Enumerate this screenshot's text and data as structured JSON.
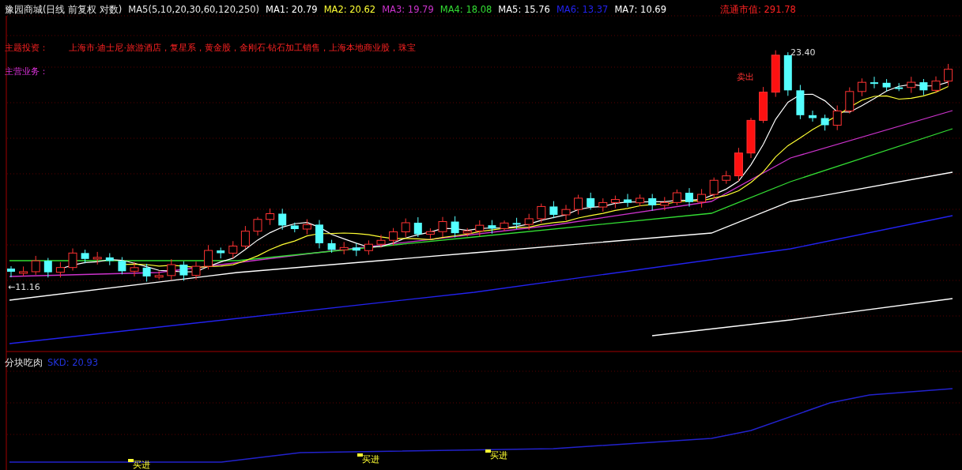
{
  "header": {
    "title": "豫园商城(日线 前复权 对数)",
    "indicator": "MA5(5,10,20,30,60,120,250)",
    "ma_values": [
      {
        "label": "MA1: 20.79",
        "color": "#ffffff"
      },
      {
        "label": "MA2: 20.62",
        "color": "#ffff33"
      },
      {
        "label": "MA3: 19.79",
        "color": "#cc33cc"
      },
      {
        "label": "MA4: 18.08",
        "color": "#33dd33"
      },
      {
        "label": "MA5: 15.76",
        "color": "#ffffff"
      },
      {
        "label": "MA6: 13.37",
        "color": "#2222ee"
      },
      {
        "label": "MA7: 10.69",
        "color": "#ffffff"
      }
    ],
    "market_cap": "流通市值: 291.78"
  },
  "info_rows": [
    {
      "label": "主题投资：",
      "value": "上海市·迪士尼·旅游酒店，复星系，黄金股，金刚石·钻石加工销售，上海本地商业股，珠宝",
      "kind": "theme"
    },
    {
      "label": "主营业务：",
      "kind": "business"
    }
  ],
  "price_labels": {
    "high": "23.40",
    "low": "←11.16"
  },
  "sell_signal": "卖出",
  "sub_panel": {
    "title": "分块吃肉",
    "reading": "SKD: 20.93",
    "signals": [
      "买进",
      "买进",
      "买进"
    ]
  }
}
